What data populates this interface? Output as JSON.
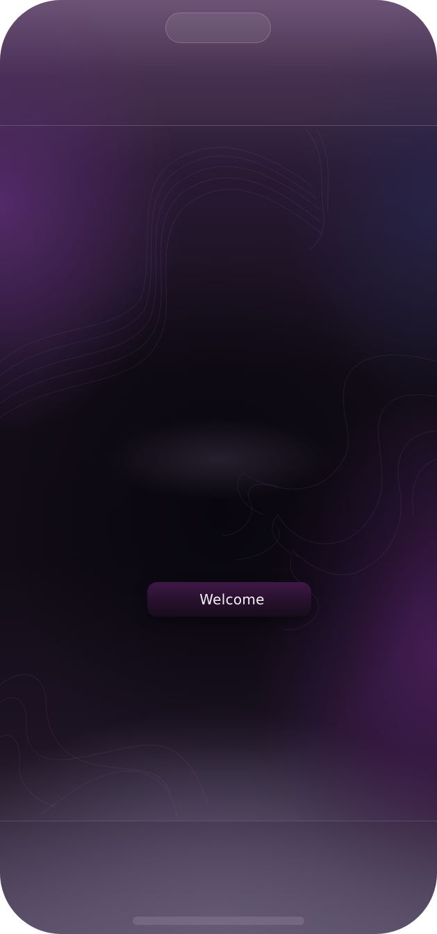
{
  "welcome_button": {
    "label": "Welcome"
  },
  "colors": {
    "background_dark": "#110c16",
    "accent_purple": "#3e1845",
    "frame_top": "#5c4566",
    "button_text": "#f3eef6"
  }
}
